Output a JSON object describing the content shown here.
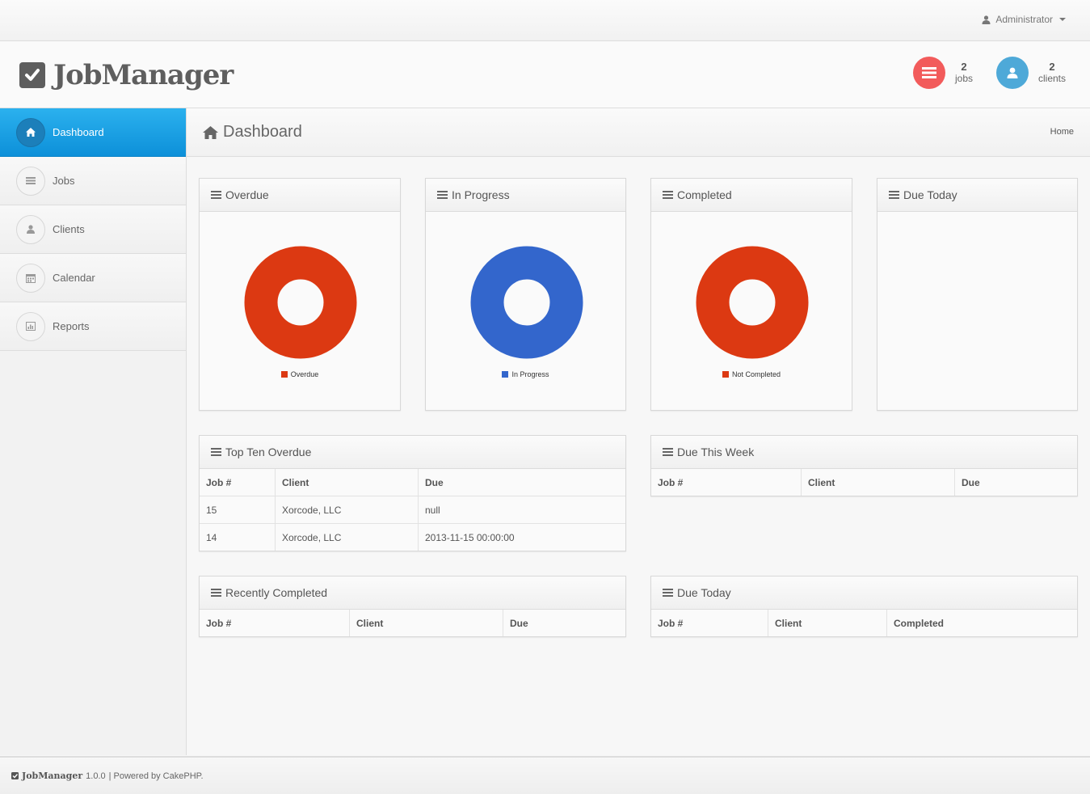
{
  "topbar": {
    "user": "Administrator"
  },
  "header": {
    "brand": "JobManager",
    "stats": [
      {
        "value": "2",
        "label": "jobs",
        "color": "#f25b5b"
      },
      {
        "value": "2",
        "label": "clients",
        "color": "#4ea9d8"
      }
    ]
  },
  "sidebar": {
    "items": [
      {
        "label": "Dashboard",
        "icon": "home-icon",
        "active": true
      },
      {
        "label": "Jobs",
        "icon": "list-icon"
      },
      {
        "label": "Clients",
        "icon": "user-icon"
      },
      {
        "label": "Calendar",
        "icon": "calendar-icon"
      },
      {
        "label": "Reports",
        "icon": "bar-chart-icon"
      }
    ]
  },
  "page": {
    "title": "Dashboard",
    "breadcrumb": "Home"
  },
  "panels": {
    "overdue": {
      "title": "Overdue"
    },
    "in_progress": {
      "title": "In Progress"
    },
    "completed": {
      "title": "Completed"
    },
    "due_today_chart": {
      "title": "Due Today"
    },
    "top_ten_overdue": {
      "title": "Top Ten Overdue",
      "columns": [
        "Job #",
        "Client",
        "Due"
      ],
      "rows": [
        [
          "15",
          "Xorcode, LLC",
          "null"
        ],
        [
          "14",
          "Xorcode, LLC",
          "2013-11-15 00:00:00"
        ]
      ]
    },
    "due_this_week": {
      "title": "Due This Week",
      "columns": [
        "Job #",
        "Client",
        "Due"
      ]
    },
    "recently_completed": {
      "title": "Recently Completed",
      "columns": [
        "Job #",
        "Client",
        "Due"
      ]
    },
    "due_today": {
      "title": "Due Today",
      "columns": [
        "Job #",
        "Client",
        "Completed"
      ]
    }
  },
  "chart_data": [
    {
      "type": "pie",
      "categories": [
        "Overdue"
      ],
      "values": [
        100
      ],
      "colors": [
        "#dc3912"
      ],
      "legend": "bottom"
    },
    {
      "type": "pie",
      "categories": [
        "In Progress"
      ],
      "values": [
        100
      ],
      "colors": [
        "#3366cc"
      ],
      "legend": "bottom"
    },
    {
      "type": "pie",
      "categories": [
        "Not Completed"
      ],
      "values": [
        100
      ],
      "colors": [
        "#dc3912"
      ],
      "legend": "bottom"
    }
  ],
  "footer": {
    "brand": "JobManager",
    "version": "1.0.0",
    "powered": "| Powered by CakePHP."
  }
}
